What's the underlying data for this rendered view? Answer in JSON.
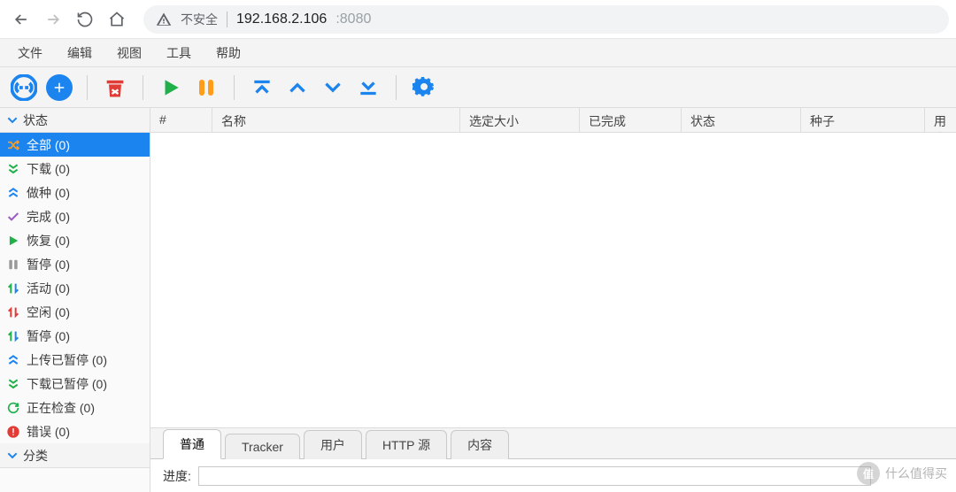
{
  "browser": {
    "security_label": "不安全",
    "ip": "192.168.2.106",
    "port": ":8080"
  },
  "menu": {
    "file": "文件",
    "edit": "编辑",
    "view": "视图",
    "tools": "工具",
    "help": "帮助"
  },
  "sidebar": {
    "header": "状态",
    "filters": [
      {
        "label": "全部 (0)"
      },
      {
        "label": "下载 (0)"
      },
      {
        "label": "做种 (0)"
      },
      {
        "label": "完成 (0)"
      },
      {
        "label": "恢复 (0)"
      },
      {
        "label": "暂停 (0)"
      },
      {
        "label": "活动 (0)"
      },
      {
        "label": "空闲 (0)"
      },
      {
        "label": "暂停 (0)"
      },
      {
        "label": "上传已暂停 (0)"
      },
      {
        "label": "下载已暂停 (0)"
      },
      {
        "label": "正在检查 (0)"
      },
      {
        "label": "错误 (0)"
      }
    ],
    "categories_header": "分类"
  },
  "columns": {
    "index": "#",
    "name": "名称",
    "size": "选定大小",
    "done": "已完成",
    "status": "状态",
    "seeds": "种子",
    "users": "用户"
  },
  "tabs": {
    "general": "普通",
    "tracker": "Tracker",
    "peers": "用户",
    "http": "HTTP 源",
    "content": "内容"
  },
  "detail": {
    "progress_label": "进度:",
    "progress_value": ""
  },
  "watermark": {
    "badge": "值",
    "text": "什么值得买"
  },
  "colors": {
    "accent": "#1b84ef",
    "green": "#1fb04a",
    "orange": "#ff9c1a",
    "red": "#e13c35",
    "purple": "#9b5bc1"
  }
}
